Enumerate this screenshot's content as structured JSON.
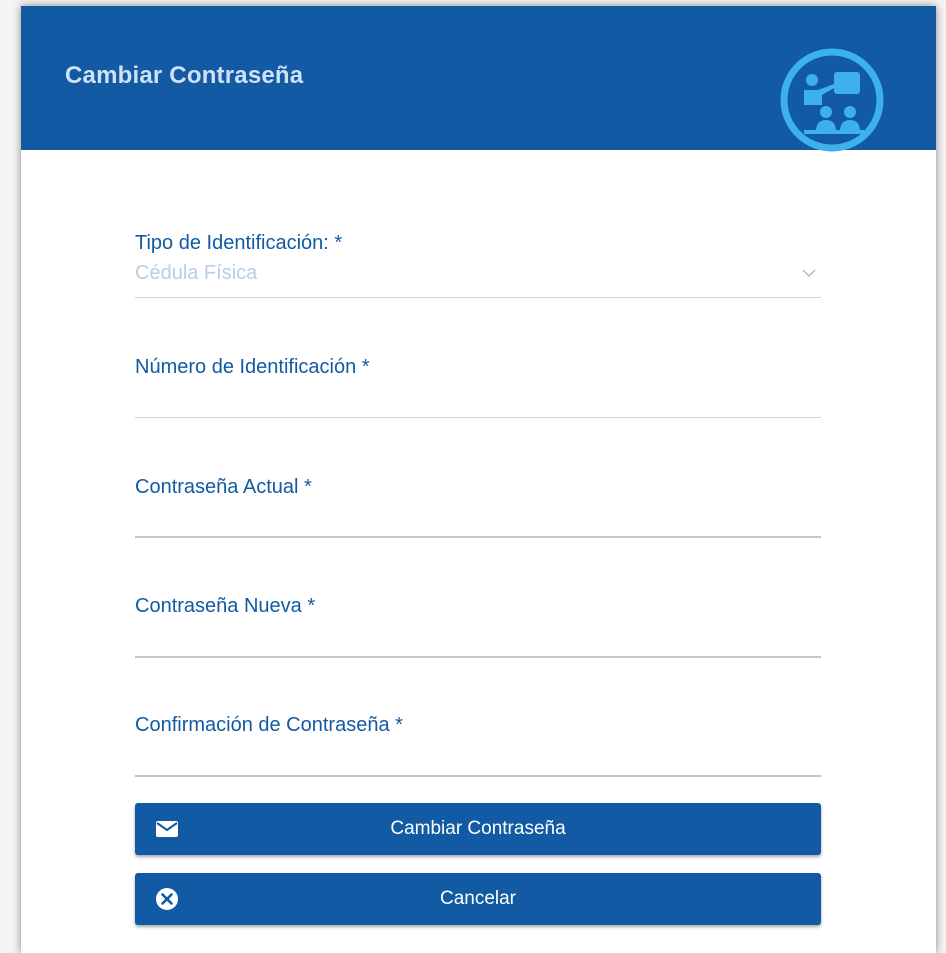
{
  "header": {
    "title": "Cambiar Contraseña",
    "logo_icon": "classroom-teacher-logo"
  },
  "form": {
    "tipo_identificacion": {
      "label": "Tipo de Identificación: *",
      "selected_value": "Cédula Física"
    },
    "numero_identificacion": {
      "label": "Número de Identificación *",
      "value": ""
    },
    "contrasena_actual": {
      "label": "Contraseña Actual *",
      "value": ""
    },
    "contrasena_nueva": {
      "label": "Contraseña Nueva *",
      "value": ""
    },
    "confirmacion_contrasena": {
      "label": "Confirmación de Contraseña *",
      "value": ""
    }
  },
  "buttons": {
    "cambiar_label": "Cambiar Contraseña",
    "cambiar_icon": "envelope-icon",
    "cancelar_label": "Cancelar",
    "cancelar_icon": "close-circle-icon"
  },
  "colors": {
    "primary": "#125aa4",
    "header_text": "#cfe1f5",
    "logo_accent": "#3db1ee",
    "placeholder_text": "#b9cde3"
  }
}
